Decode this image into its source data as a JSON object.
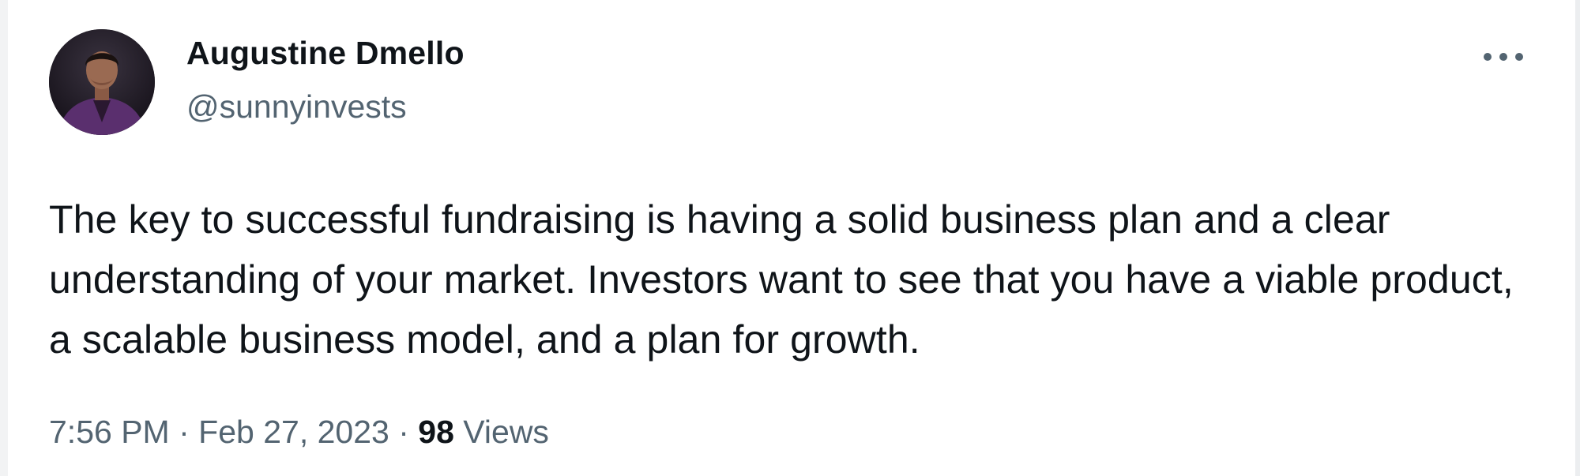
{
  "author": {
    "display_name": "Augustine Dmello",
    "handle": "@sunnyinvests",
    "avatar": "profile-photo"
  },
  "tweet": {
    "text": "The key to successful fundraising is having a solid business plan and a clear understanding of your market. Investors want to see that you have a viable product, a scalable business model, and a plan for growth."
  },
  "meta": {
    "time": "7:56 PM",
    "separator": "·",
    "date": "Feb 27, 2023",
    "views_count": "98",
    "views_label": "Views"
  },
  "icons": {
    "more": "more-horizontal-icon"
  },
  "colors": {
    "primary_text": "#0f1419",
    "secondary_text": "#536471",
    "background": "#ffffff"
  }
}
